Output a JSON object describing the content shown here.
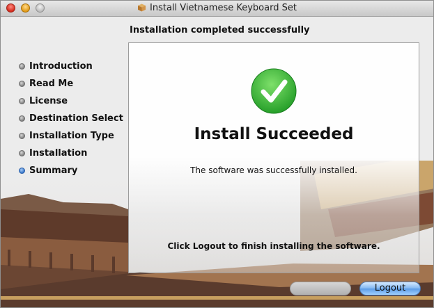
{
  "window": {
    "title": "Install Vietnamese Keyboard Set"
  },
  "header": {
    "title": "Installation completed successfully"
  },
  "sidebar": {
    "items": [
      {
        "label": "Introduction",
        "state": "done"
      },
      {
        "label": "Read Me",
        "state": "done"
      },
      {
        "label": "License",
        "state": "done"
      },
      {
        "label": "Destination Select",
        "state": "done"
      },
      {
        "label": "Installation Type",
        "state": "done"
      },
      {
        "label": "Installation",
        "state": "done"
      },
      {
        "label": "Summary",
        "state": "current"
      }
    ]
  },
  "main": {
    "status_icon": "checkmark-icon",
    "heading": "Install Succeeded",
    "message": "The software was successfully installed.",
    "instruction": "Click Logout to finish installing the software."
  },
  "buttons": {
    "logout_label": "Logout",
    "disabled_button_state": "disabled"
  },
  "colors": {
    "success": "#2fb82f",
    "accent": "#5a9ae6",
    "current_step": "#2e6fc6"
  }
}
